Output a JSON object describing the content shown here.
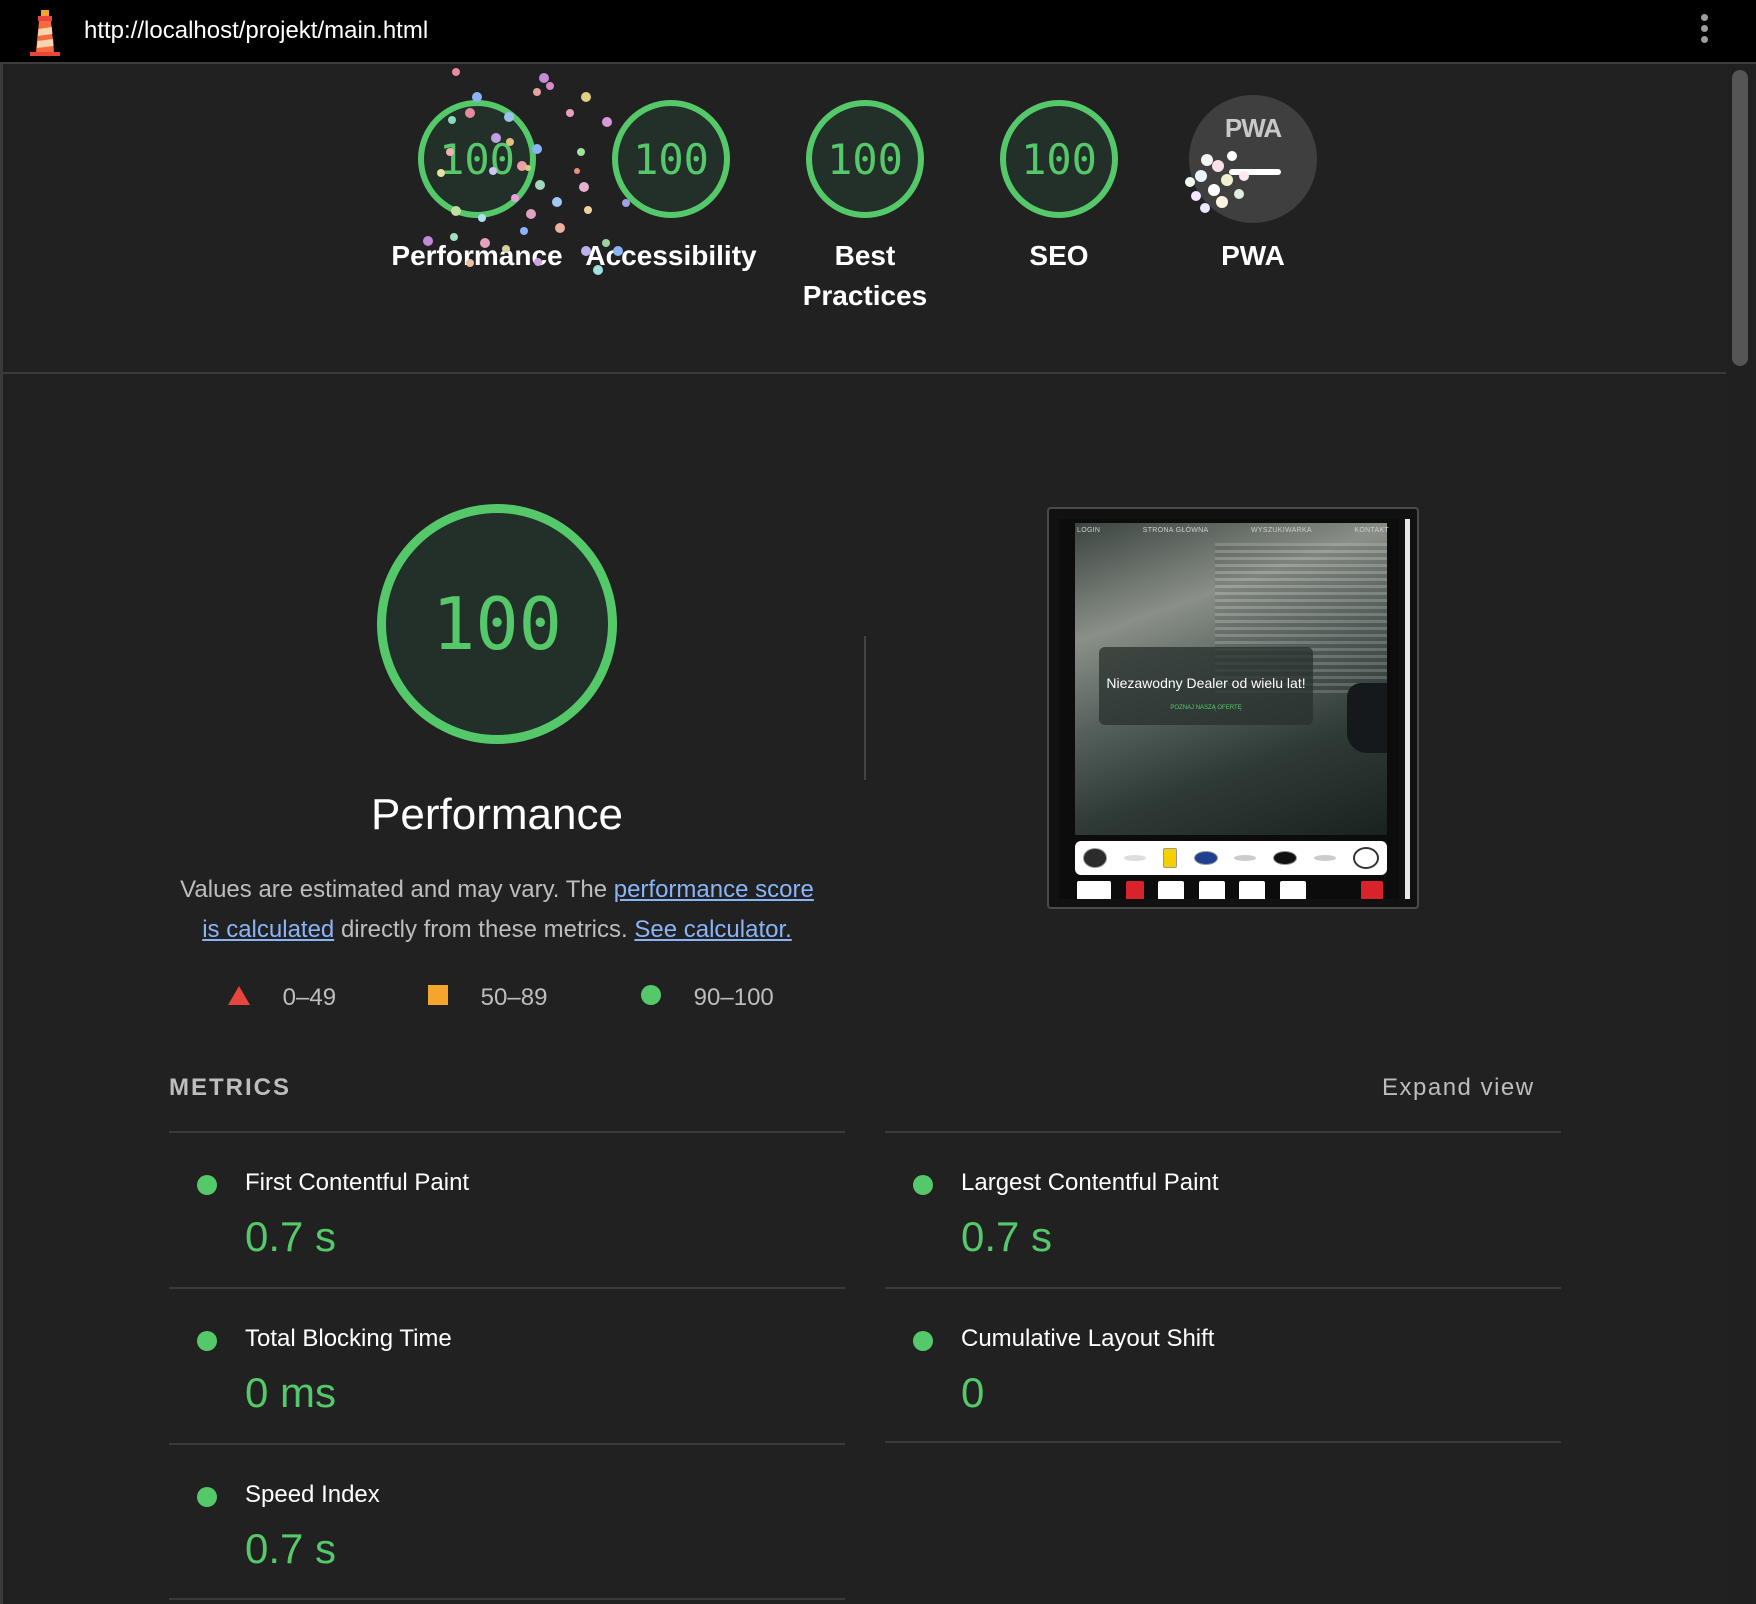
{
  "topbar": {
    "url": "http://localhost/projekt/main.html"
  },
  "gauges": [
    {
      "score": "100",
      "label": "Performance"
    },
    {
      "score": "100",
      "label": "Accessibility"
    },
    {
      "score": "100",
      "label": "Best Practices"
    },
    {
      "score": "100",
      "label": "SEO"
    },
    {
      "score": "",
      "label": "PWA",
      "badge": "PWA"
    }
  ],
  "performance": {
    "score": "100",
    "title": "Performance",
    "desc_pre": "Values are estimated and may vary. The ",
    "link1": "performance score is calculated",
    "desc_mid": " directly from these metrics. ",
    "link2": "See calculator."
  },
  "legend": [
    {
      "shape": "triangle",
      "range": "0–49",
      "color": "#e8453c"
    },
    {
      "shape": "square",
      "range": "50–89",
      "color": "#f4a52c"
    },
    {
      "shape": "circle",
      "range": "90–100",
      "color": "#55c96a"
    }
  ],
  "thumbnail": {
    "nav": [
      "LOGIN",
      "STRONA GŁÓWNA",
      "WYSZUKIWARKA",
      "KONTAKT"
    ],
    "headline": "Niezawodny Dealer od wielu lat!",
    "cta": "POZNAJ NASZĄ OFERTĘ"
  },
  "metrics": {
    "heading": "METRICS",
    "expand": "Expand view",
    "items": [
      {
        "name": "First Contentful Paint",
        "value": "0.7 s"
      },
      {
        "name": "Largest Contentful Paint",
        "value": "0.7 s"
      },
      {
        "name": "Total Blocking Time",
        "value": "0 ms"
      },
      {
        "name": "Cumulative Layout Shift",
        "value": "0"
      },
      {
        "name": "Speed Index",
        "value": "0.7 s"
      }
    ]
  },
  "colors": {
    "pass": "#55c96a",
    "fail": "#e8453c",
    "average": "#f4a52c",
    "link": "#8ab4f8"
  }
}
